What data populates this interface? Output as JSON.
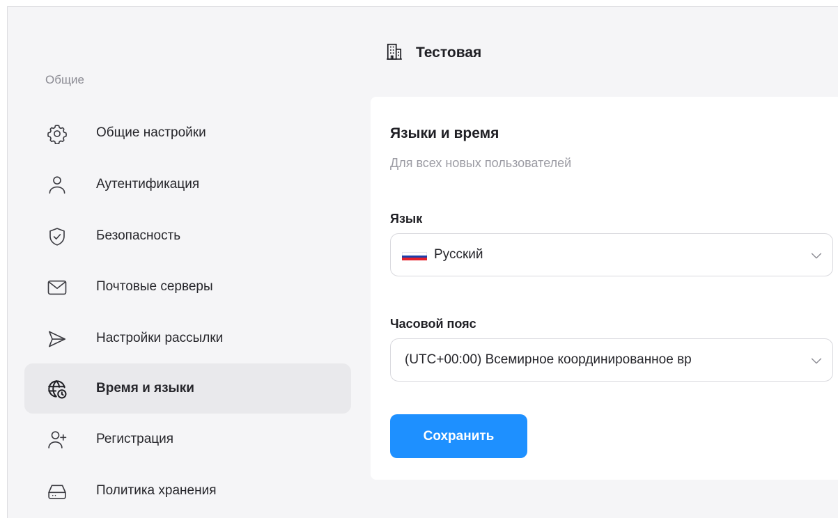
{
  "sidebar": {
    "section_label": "Общие",
    "items": [
      {
        "label": "Общие настройки",
        "icon": "gear-icon",
        "active": false
      },
      {
        "label": "Аутентификация",
        "icon": "user-icon",
        "active": false
      },
      {
        "label": "Безопасность",
        "icon": "shield-icon",
        "active": false
      },
      {
        "label": "Почтовые серверы",
        "icon": "mail-icon",
        "active": false
      },
      {
        "label": "Настройки рассылки",
        "icon": "send-icon",
        "active": false
      },
      {
        "label": "Время и языки",
        "icon": "globe-clock-icon",
        "active": true
      },
      {
        "label": "Регистрация",
        "icon": "user-add-icon",
        "active": false
      },
      {
        "label": "Политика хранения",
        "icon": "storage-icon",
        "active": false
      }
    ]
  },
  "header": {
    "org_name": "Тестовая",
    "icon": "building-icon"
  },
  "card": {
    "title": "Языки и время",
    "subtitle": "Для всех новых пользователей",
    "language": {
      "label": "Язык",
      "value": "Русский",
      "flag_colors": [
        "#ffffff",
        "#1c3faa",
        "#e4202b"
      ]
    },
    "timezone": {
      "label": "Часовой пояс",
      "value": "(UTC+00:00) Всемирное координированное вр"
    },
    "save_label": "Сохранить"
  },
  "colors": {
    "accent": "#1e90ff",
    "active_bg": "#e9e9ec",
    "page_bg": "#f5f5f7"
  }
}
